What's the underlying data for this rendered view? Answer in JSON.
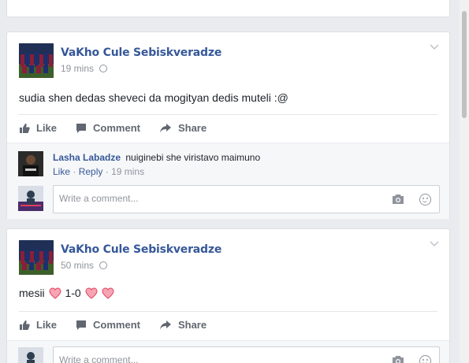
{
  "posts": [
    {
      "author": "VaKho Cule Sebiskveradze",
      "time": "19 mins",
      "text": "sudia shen dedas sheveci da mogityan dedis muteli :@",
      "actions": {
        "like": "Like",
        "comment": "Comment",
        "share": "Share"
      },
      "comments": [
        {
          "author": "Lasha Labadze",
          "text": "nuiginebi she viristavo maimuno",
          "like": "Like",
          "reply": "Reply",
          "time": "19 mins"
        }
      ],
      "write_placeholder": "Write a comment..."
    },
    {
      "author": "VaKho Cule Sebiskveradze",
      "time": "50 mins",
      "text_before": "mesii",
      "text_middle": "1-0",
      "actions": {
        "like": "Like",
        "comment": "Comment",
        "share": "Share"
      },
      "write_placeholder": "Write a comment..."
    }
  ],
  "colors": {
    "link": "#365899",
    "muted": "#90949c",
    "heart": "#f25268"
  },
  "icons": [
    "globe-icon",
    "chevron-down-icon",
    "like-icon",
    "comment-icon",
    "share-icon",
    "camera-icon",
    "emoji-icon",
    "heart-icon"
  ]
}
